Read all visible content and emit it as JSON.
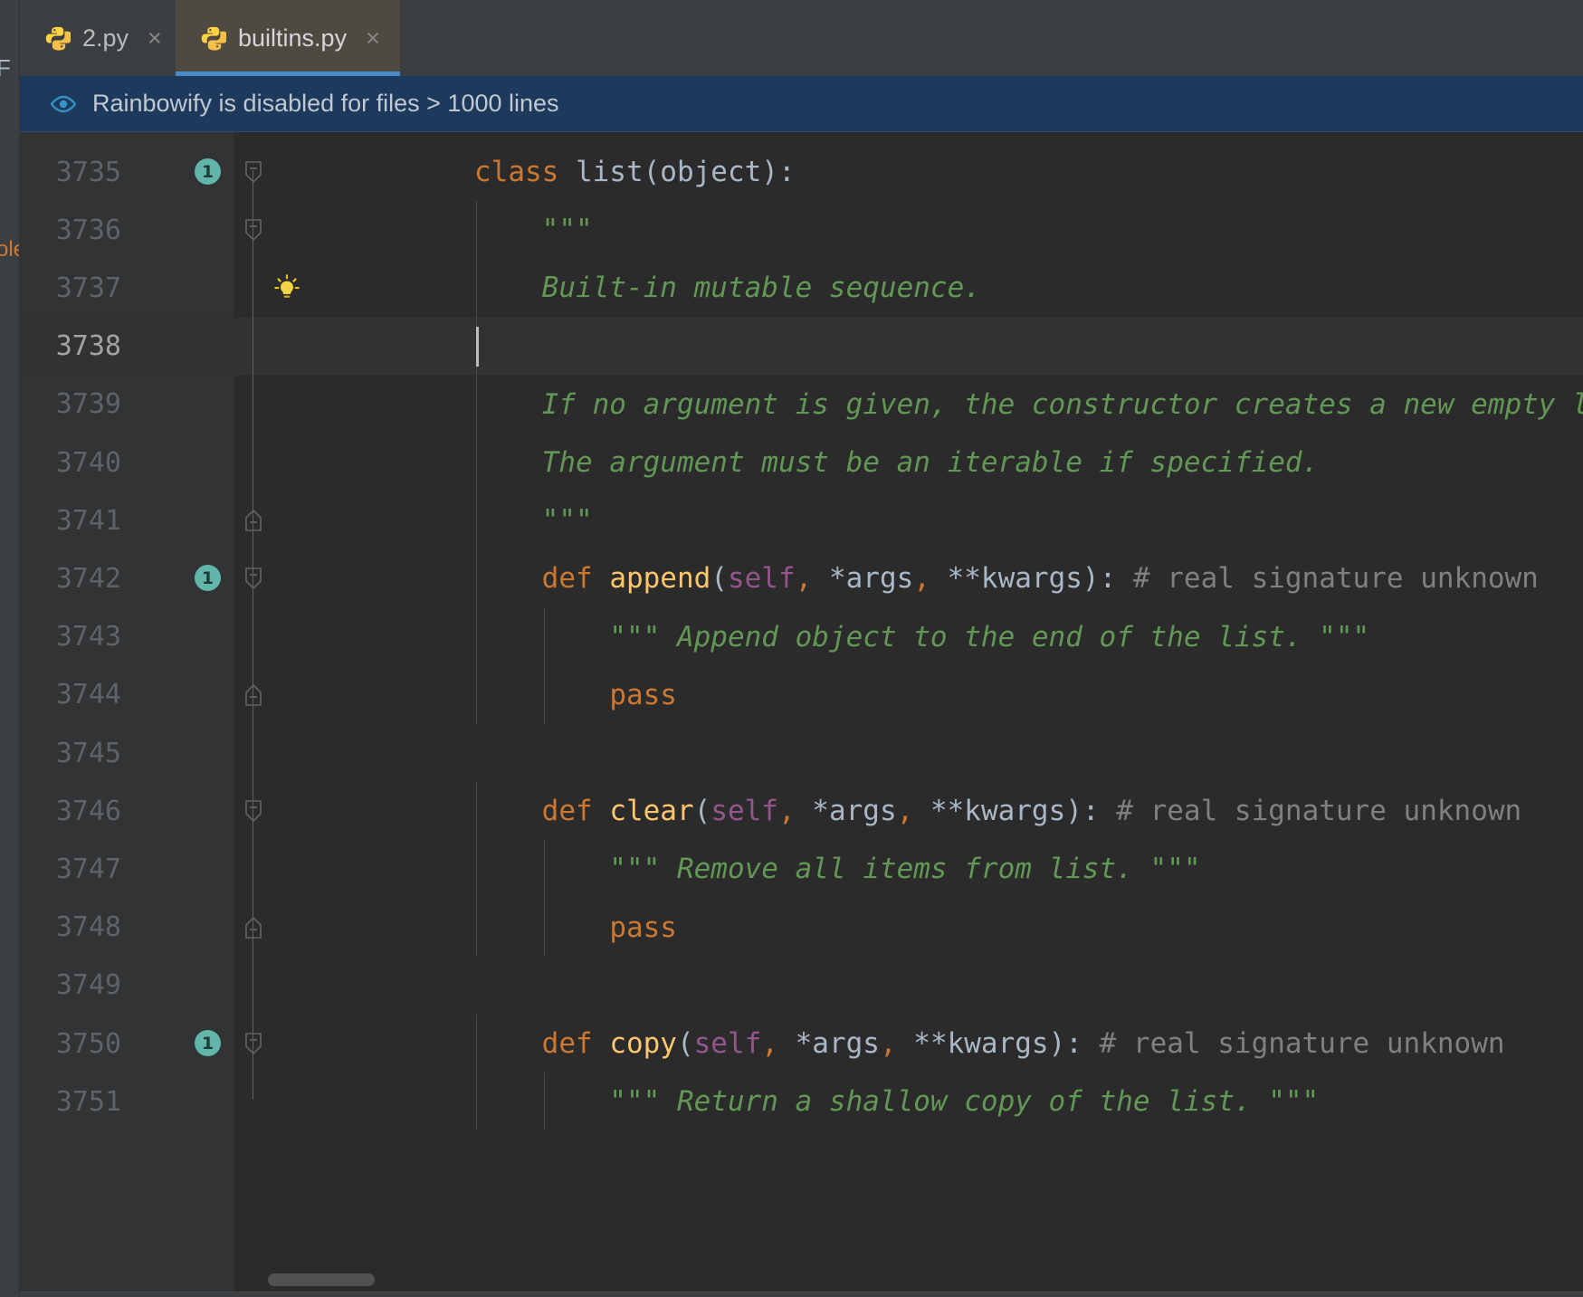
{
  "window": {
    "left_sliver_labels": [
      "F",
      "ole"
    ]
  },
  "tabs": [
    {
      "label": "2.py",
      "icon": "python-file-icon",
      "close": "×",
      "active": false
    },
    {
      "label": "builtins.py",
      "icon": "python-file-icon",
      "close": "×",
      "active": true
    }
  ],
  "notification": {
    "icon": "eye-icon",
    "text": "Rainbowify is disabled for files > 1000 lines",
    "background": "#1d3a5c"
  },
  "editor": {
    "file": "builtins.py",
    "current_line": 3738,
    "colors": {
      "background": "#2b2b2b",
      "gutter": "#313335",
      "current_line": "#323232",
      "keyword": "#cc7832",
      "function": "#ffc66d",
      "self": "#94558d",
      "docstring": "#629755",
      "comment": "#808080",
      "identifier": "#a9b7c6",
      "badge": "#62b5a9",
      "accent": "#4a88c7"
    },
    "lines": [
      {
        "no": "3735",
        "badge": "1",
        "fold": "open",
        "bulb": false,
        "current": false,
        "indent": 0,
        "tokens": [
          {
            "t": "class ",
            "c": "t-kw"
          },
          {
            "t": "list(object):",
            "c": "t-cls"
          }
        ]
      },
      {
        "no": "3736",
        "badge": null,
        "fold": "mid",
        "bulb": false,
        "current": false,
        "indent": 1,
        "tokens": [
          {
            "t": "    \"\"\"",
            "c": "t-doc"
          }
        ]
      },
      {
        "no": "3737",
        "badge": null,
        "fold": null,
        "bulb": true,
        "current": false,
        "indent": 1,
        "tokens": [
          {
            "t": "    Built-in mutable sequence.",
            "c": "t-doc"
          }
        ]
      },
      {
        "no": "3738",
        "badge": null,
        "fold": null,
        "bulb": false,
        "current": true,
        "indent": 1,
        "tokens": [
          {
            "t": "    ",
            "c": "t-doc"
          }
        ]
      },
      {
        "no": "3739",
        "badge": null,
        "fold": null,
        "bulb": false,
        "current": false,
        "indent": 1,
        "tokens": [
          {
            "t": "    If no argument is given, the constructor creates a new empty list.",
            "c": "t-doc"
          }
        ]
      },
      {
        "no": "3740",
        "badge": null,
        "fold": null,
        "bulb": false,
        "current": false,
        "indent": 1,
        "tokens": [
          {
            "t": "    The argument must be an iterable if specified.",
            "c": "t-doc"
          }
        ]
      },
      {
        "no": "3741",
        "badge": null,
        "fold": "end",
        "bulb": false,
        "current": false,
        "indent": 1,
        "tokens": [
          {
            "t": "    \"\"\"",
            "c": "t-doc"
          }
        ]
      },
      {
        "no": "3742",
        "badge": "1",
        "fold": "open",
        "bulb": false,
        "current": false,
        "indent": 1,
        "tokens": [
          {
            "t": "    ",
            "c": "t-punct"
          },
          {
            "t": "def ",
            "c": "t-kw"
          },
          {
            "t": "append",
            "c": "t-fn"
          },
          {
            "t": "(",
            "c": "t-punct"
          },
          {
            "t": "self",
            "c": "t-self"
          },
          {
            "t": ", ",
            "c": "t-kw"
          },
          {
            "t": "*args",
            "c": "t-param"
          },
          {
            "t": ", ",
            "c": "t-kw"
          },
          {
            "t": "**kwargs",
            "c": "t-param"
          },
          {
            "t": "): ",
            "c": "t-punct"
          },
          {
            "t": "# real signature unknown",
            "c": "t-comment"
          }
        ]
      },
      {
        "no": "3743",
        "badge": null,
        "fold": null,
        "bulb": false,
        "current": false,
        "indent": 2,
        "tokens": [
          {
            "t": "        \"\"\" Append object to the end of the list. \"\"\"",
            "c": "t-doc"
          }
        ]
      },
      {
        "no": "3744",
        "badge": null,
        "fold": "end",
        "bulb": false,
        "current": false,
        "indent": 2,
        "tokens": [
          {
            "t": "        ",
            "c": "t-punct"
          },
          {
            "t": "pass",
            "c": "t-kw"
          }
        ]
      },
      {
        "no": "3745",
        "badge": null,
        "fold": null,
        "bulb": false,
        "current": false,
        "indent": 0,
        "tokens": []
      },
      {
        "no": "3746",
        "badge": null,
        "fold": "open",
        "bulb": false,
        "current": false,
        "indent": 1,
        "tokens": [
          {
            "t": "    ",
            "c": "t-punct"
          },
          {
            "t": "def ",
            "c": "t-kw"
          },
          {
            "t": "clear",
            "c": "t-fn"
          },
          {
            "t": "(",
            "c": "t-punct"
          },
          {
            "t": "self",
            "c": "t-self"
          },
          {
            "t": ", ",
            "c": "t-kw"
          },
          {
            "t": "*args",
            "c": "t-param"
          },
          {
            "t": ", ",
            "c": "t-kw"
          },
          {
            "t": "**kwargs",
            "c": "t-param"
          },
          {
            "t": "): ",
            "c": "t-punct"
          },
          {
            "t": "# real signature unknown",
            "c": "t-comment"
          }
        ]
      },
      {
        "no": "3747",
        "badge": null,
        "fold": null,
        "bulb": false,
        "current": false,
        "indent": 2,
        "tokens": [
          {
            "t": "        \"\"\" Remove all items from list. \"\"\"",
            "c": "t-doc"
          }
        ]
      },
      {
        "no": "3748",
        "badge": null,
        "fold": "end",
        "bulb": false,
        "current": false,
        "indent": 2,
        "tokens": [
          {
            "t": "        ",
            "c": "t-punct"
          },
          {
            "t": "pass",
            "c": "t-kw"
          }
        ]
      },
      {
        "no": "3749",
        "badge": null,
        "fold": null,
        "bulb": false,
        "current": false,
        "indent": 0,
        "tokens": []
      },
      {
        "no": "3750",
        "badge": "1",
        "fold": "open",
        "bulb": false,
        "current": false,
        "indent": 1,
        "tokens": [
          {
            "t": "    ",
            "c": "t-punct"
          },
          {
            "t": "def ",
            "c": "t-kw"
          },
          {
            "t": "copy",
            "c": "t-fn"
          },
          {
            "t": "(",
            "c": "t-punct"
          },
          {
            "t": "self",
            "c": "t-self"
          },
          {
            "t": ", ",
            "c": "t-kw"
          },
          {
            "t": "*args",
            "c": "t-param"
          },
          {
            "t": ", ",
            "c": "t-kw"
          },
          {
            "t": "**kwargs",
            "c": "t-param"
          },
          {
            "t": "): ",
            "c": "t-punct"
          },
          {
            "t": "# real signature unknown",
            "c": "t-comment"
          }
        ]
      },
      {
        "no": "3751",
        "badge": null,
        "fold": null,
        "bulb": false,
        "current": false,
        "indent": 2,
        "tokens": [
          {
            "t": "        \"\"\" Return a shallow copy of the list. \"\"\"",
            "c": "t-doc"
          }
        ]
      }
    ],
    "scrollbar": {
      "orientation": "horizontal",
      "name": "horizontal-scrollbar"
    }
  }
}
